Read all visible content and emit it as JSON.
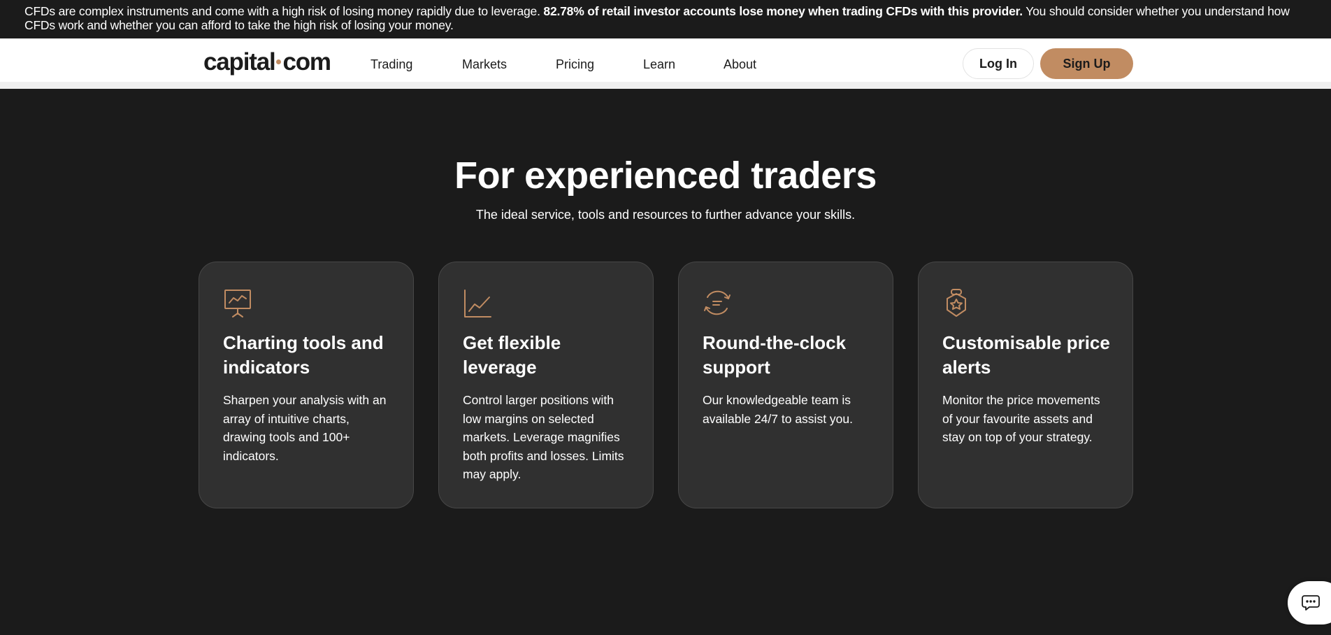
{
  "risk_banner": {
    "text_before": "CFDs are complex instruments and come with a high risk of losing money rapidly due to leverage. ",
    "text_bold": "82.78% of retail investor accounts lose money when trading CFDs with this provider.",
    "text_after": " You should consider whether you understand how CFDs work and whether you can afford to take the high risk of losing your money."
  },
  "header": {
    "logo_left": "capital",
    "logo_right": "com",
    "nav": [
      "Trading",
      "Markets",
      "Pricing",
      "Learn",
      "About"
    ],
    "login_label": "Log In",
    "signup_label": "Sign Up"
  },
  "section": {
    "title": "For experienced traders",
    "subtitle": "The ideal service, tools and resources to further advance your skills."
  },
  "cards": [
    {
      "icon": "presentation-chart-icon",
      "title": "Charting tools and indicators",
      "desc": "Sharpen your analysis with an array of intuitive charts, drawing tools and 100+ indicators."
    },
    {
      "icon": "line-chart-icon",
      "title": "Get flexible leverage",
      "desc": "Control larger positions with low margins on selected markets. Leverage magnifies both profits and losses. Limits may apply."
    },
    {
      "icon": "support-chat-icon",
      "title": "Round-the-clock support",
      "desc": "Our knowledgeable team is available 24/7 to assist you."
    },
    {
      "icon": "price-alert-icon",
      "title": "Customisable price alerts",
      "desc": "Monitor the price movements of your favourite assets and stay on top of your strategy."
    }
  ],
  "colors": {
    "accent": "#c18c62",
    "background": "#1b1b1b",
    "card": "#303030"
  },
  "chat": {
    "icon": "chat-icon"
  }
}
